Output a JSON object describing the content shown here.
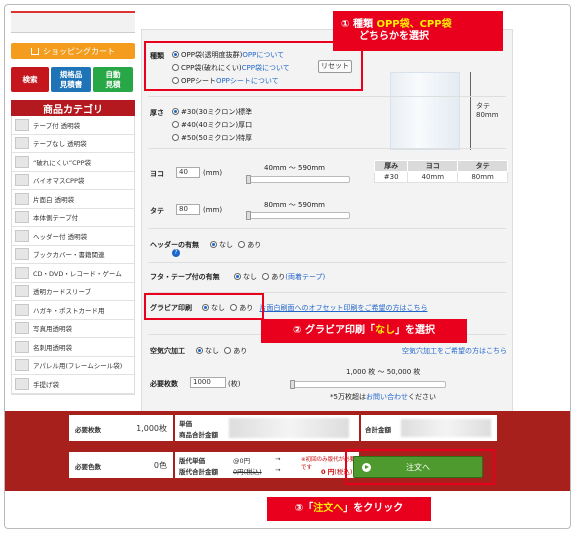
{
  "sidebar": {
    "cart_label": "ショッピングカート",
    "buttons": [
      "検索",
      "規格品\n見積書",
      "自動\n見積"
    ],
    "category_title": "商品カテゴリ",
    "categories": [
      "テープ付 透明袋",
      "テープなし 透明袋",
      "“破れにくい”CPP袋",
      "バイオマスCPP袋",
      "片面白 透明袋",
      "本体側テープ付",
      "ヘッダー付 透明袋",
      "ブックカバー・書籍関連",
      "CD・DVD・レコード・ゲーム",
      "透明カードスリーブ",
      "ハガキ・ポストカード用",
      "写真用透明袋",
      "名刺用透明袋",
      "アパレル用(フレームシール袋)",
      "手提げ袋"
    ]
  },
  "form": {
    "type_label": "種類",
    "type_options": [
      {
        "text": "OPP袋(透明度抜群)",
        "link": "OPPについて",
        "selected": true
      },
      {
        "text": "CPP袋(破れにくい)",
        "link": "CPP袋について",
        "selected": false
      },
      {
        "text": "OPPシート",
        "link": "OPPシートについて",
        "selected": false
      }
    ],
    "reset_label": "リセット",
    "thickness_label": "厚さ",
    "thickness_options": [
      {
        "text": "#30(30ミクロン)標準",
        "selected": true
      },
      {
        "text": "#40(40ミクロン)厚口",
        "selected": false
      },
      {
        "text": "#50(50ミクロン)特厚",
        "selected": false
      }
    ],
    "width_label": "ヨコ",
    "width_value": "40",
    "width_unit": "(mm)",
    "width_range": "40mm ～ 590mm",
    "height_label": "タテ",
    "height_value": "80",
    "height_unit": "(mm)",
    "height_range": "80mm ～ 590mm",
    "preview_dim": "タテ\n80mm",
    "header_hole_label": "ヘッダーの有無",
    "header_hole_options": [
      "なし",
      "あり"
    ],
    "flap_label": "フタ・テープ付の有無",
    "flap_options": [
      "なし",
      "あり"
    ],
    "flap_link": "(両着テープ)",
    "gravure_label": "グラビア印刷",
    "gravure_options": [
      "なし",
      "あり"
    ],
    "gravure_link": "片面白刷面へのオフセット印刷をご希望の方はこちら",
    "air_hole_label": "空気穴加工",
    "air_hole_options": [
      "なし",
      "あり"
    ],
    "air_hole_note": "空気穴加工をご希望の方はこちら",
    "qty_label": "必要枚数",
    "qty_value": "1000",
    "qty_unit": "(枚)",
    "qty_range": "1,000 枚 ～ 50,000 枚",
    "qty_note": "*5万枚超は",
    "qty_link": "お問い合わせ",
    "qty_note_tail": "ください"
  },
  "spec_table": {
    "headers": [
      "厚み",
      "ヨコ",
      "タテ"
    ],
    "row": [
      "#30",
      "40mm",
      "80mm"
    ]
  },
  "bottom": {
    "qty_label": "必要枚数",
    "qty_value": "1,000枚",
    "colors_label": "必要色数",
    "colors_value": "0色",
    "unit_price_label": "単価",
    "subtotal_label": "商品合計金額",
    "plate_label": "版代単価",
    "plate_total_label": "版代合計金額",
    "plate_price": "@0円",
    "plate_arrow": "→",
    "plate_total": "0円(税込)",
    "plate_total_after": "→",
    "plate_zero": "0 円",
    "plate_zero_tax": "(税込)",
    "plate_note": "※初回のみ版代が必要です",
    "grand_total_label": "合計金額",
    "order_label": "注文へ"
  },
  "callouts": {
    "c1_line1_prefix": "① 種類 ",
    "c1_line1_hl": "OPP袋、CPP袋",
    "c1_line2": "どちらかを選択",
    "c2_prefix": "② グラビア印刷「",
    "c2_hl": "なし",
    "c2_suffix": "」を選択",
    "c3_prefix": "③「",
    "c3_hl": "注文へ",
    "c3_suffix": "」をクリック"
  },
  "colors": {
    "accent_red": "#e8001c",
    "bottom_bar": "#a8201c",
    "order_green": "#4f9a2e",
    "cart_orange": "#f39c1d",
    "link_blue": "#2266cc"
  }
}
